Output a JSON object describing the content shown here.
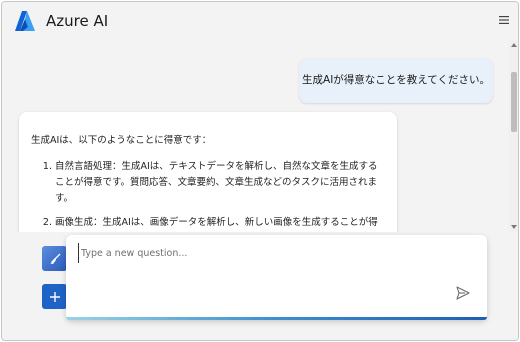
{
  "app": {
    "title": "Azure AI",
    "logo_icon": "azure-logo-icon",
    "menu_icon": "hamburger-menu-icon",
    "brand_color": "#1f63c6"
  },
  "chat": {
    "user_message": "生成AIが得意なことを教えてください。",
    "answer": {
      "intro": "生成AIは、以下のようなことに得意です：",
      "items": [
        "自然言語処理：生成AIは、テキストデータを解析し、自然な文章を生成することが得意です。質問応答、文章要約、文章生成などのタスクに活用されます。",
        "画像生成：生成AIは、画像データを解析し、新しい画像を生成することが得意です。例えば、スタイル変換や画像修復などのタスクに活用されます。"
      ]
    }
  },
  "composer": {
    "placeholder": "Type a new question...",
    "value": "",
    "send_icon": "send-icon"
  },
  "actions": {
    "clear_icon": "broom-icon",
    "new_icon": "plus-icon"
  }
}
